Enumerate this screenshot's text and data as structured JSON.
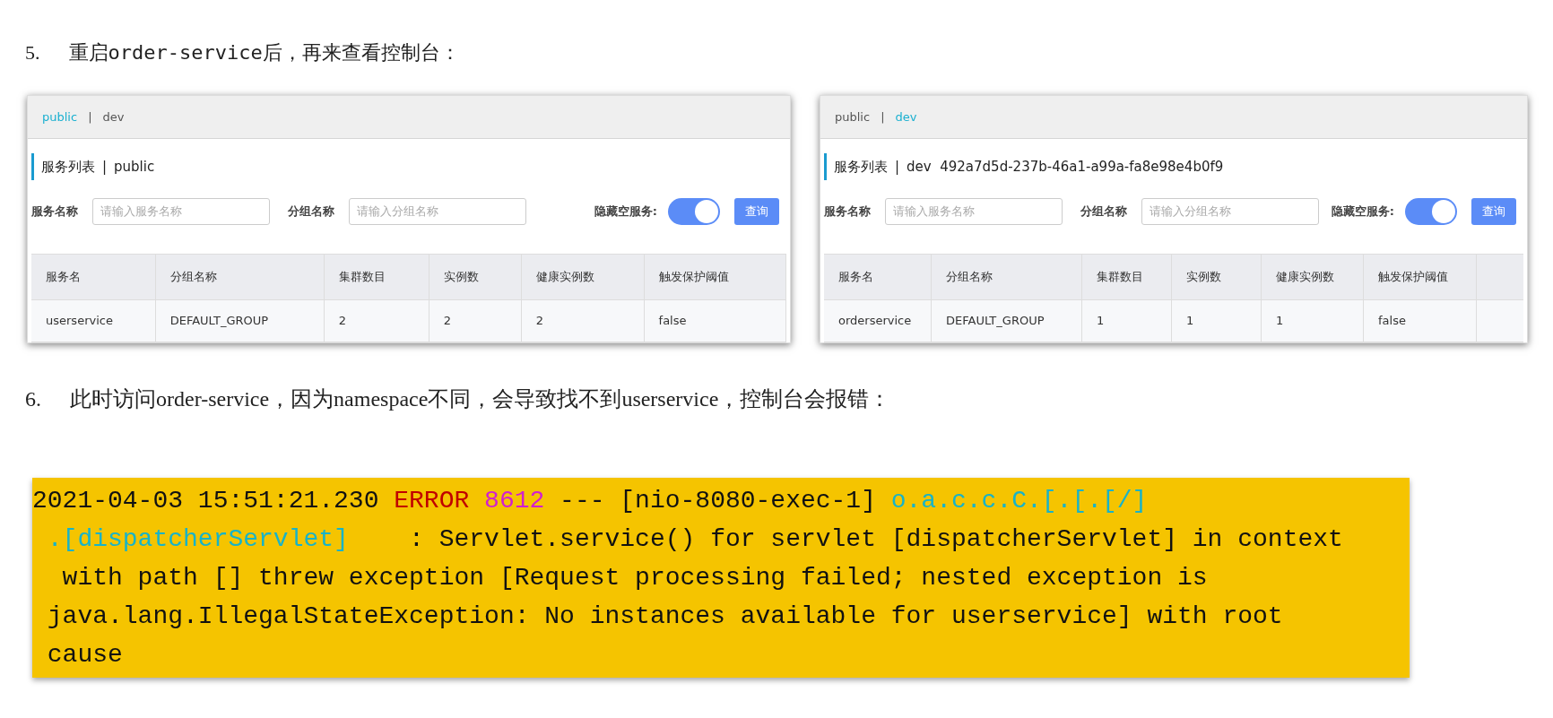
{
  "step_5": {
    "number": "5.",
    "text": "重启order-service后，再来查看控制台："
  },
  "consoles": [
    {
      "tabs": [
        {
          "label": "public",
          "selected": true
        },
        {
          "label": "dev",
          "selected": false
        }
      ],
      "tab_separator": "|",
      "heading": "服务列表",
      "heading_separator": "|",
      "namespace": "public",
      "service_label": "服务名称",
      "service_placeholder": "请输入服务名称",
      "group_label": "分组名称",
      "group_placeholder": "请输入分组名称",
      "hide_empty_label": "隐藏空服务:",
      "hide_empty_on": true,
      "query_button": "查询",
      "columns": [
        "服务名",
        "分组名称",
        "集群数目",
        "实例数",
        "健康实例数",
        "触发保护阈值"
      ],
      "rows": [
        [
          "userservice",
          "DEFAULT_GROUP",
          "2",
          "2",
          "2",
          "false"
        ]
      ]
    },
    {
      "tabs": [
        {
          "label": "public",
          "selected": false
        },
        {
          "label": "dev",
          "selected": true
        }
      ],
      "tab_separator": "|",
      "heading": "服务列表",
      "heading_separator": "|",
      "namespace": "dev  492a7d5d-237b-46a1-a99a-fa8e98e4b0f9",
      "service_label": "服务名称",
      "service_placeholder": "请输入服务名称",
      "group_label": "分组名称",
      "group_placeholder": "请输入分组名称",
      "hide_empty_label": "隐藏空服务:",
      "hide_empty_on": true,
      "query_button": "查询",
      "columns": [
        "服务名",
        "分组名称",
        "集群数目",
        "实例数",
        "健康实例数",
        "触发保护阈值"
      ],
      "rows": [
        [
          "orderservice",
          "DEFAULT_GROUP",
          "1",
          "1",
          "1",
          "false"
        ]
      ]
    }
  ],
  "step_6": {
    "number": "6.",
    "text": "此时访问order-service，因为namespace不同，会导致找不到userservice，控制台会报错："
  },
  "log": {
    "lines": [
      [
        {
          "kind": "plain",
          "text": "2021-04-03 15:51:21.230 "
        },
        {
          "kind": "error",
          "text": "ERROR"
        },
        {
          "kind": "pid",
          "text": " 8612"
        },
        {
          "kind": "plain",
          "text": " --- [nio-8080-exec-1] "
        },
        {
          "kind": "logger",
          "text": "o.a.c.c.C.[.[.[/]"
        }
      ],
      [
        {
          "kind": "logger",
          "text": " .[dispatcherServlet]"
        },
        {
          "kind": "plain",
          "text": "    : Servlet.service() for servlet [dispatcherServlet] in context"
        }
      ],
      [
        {
          "kind": "plain",
          "text": "  with path [] threw exception [Request processing failed; nested exception is"
        }
      ],
      [
        {
          "kind": "plain",
          "text": " java.lang.IllegalStateException: No instances available for userservice] with root"
        }
      ],
      [
        {
          "kind": "plain",
          "text": " cause"
        }
      ]
    ]
  }
}
